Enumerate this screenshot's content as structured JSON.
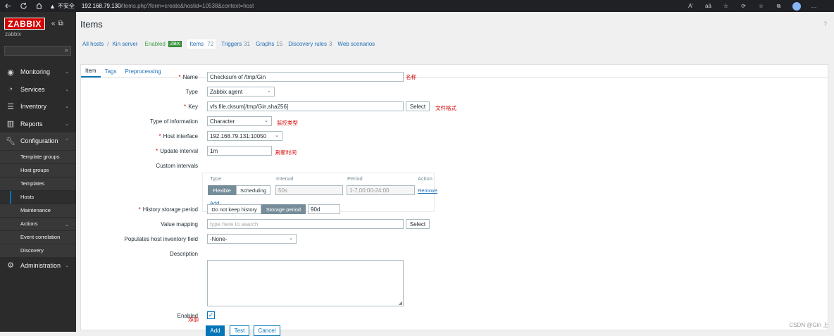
{
  "browser": {
    "security_label": "不安全",
    "url_host": "192.168.79.130",
    "url_path": "/items.php?form=create&hostid=10538&context=host",
    "read_aloud": "Aʹ",
    "translate": "aā"
  },
  "sidebar": {
    "logo": "ZABBIX",
    "server_name": "zabbix",
    "search_placeholder": "",
    "menu": [
      {
        "label": "Monitoring",
        "icon": "eye-icon"
      },
      {
        "label": "Services",
        "icon": "clock-icon"
      },
      {
        "label": "Inventory",
        "icon": "list-icon"
      },
      {
        "label": "Reports",
        "icon": "chart-icon"
      },
      {
        "label": "Configuration",
        "icon": "wrench-icon"
      },
      {
        "label": "Administration",
        "icon": "gear-icon"
      }
    ],
    "config_items": [
      "Template groups",
      "Host groups",
      "Templates",
      "Hosts",
      "Maintenance",
      "Actions",
      "Event correlation",
      "Discovery"
    ]
  },
  "page": {
    "title": "Items",
    "help": "?"
  },
  "breadcrumb": {
    "all_hosts": "All hosts",
    "separator": "/",
    "host": "Kin server",
    "enabled": "Enabled",
    "zbx": "ZBX",
    "items": "Items",
    "items_count": "72",
    "triggers": "Triggers",
    "triggers_count": "31",
    "graphs": "Graphs",
    "graphs_count": "15",
    "discovery": "Discovery rules",
    "discovery_count": "3",
    "web": "Web scenarios"
  },
  "tabs": [
    "Item",
    "Tags",
    "Preprocessing"
  ],
  "form": {
    "name_label": "Name",
    "name_value": "Checksum of /tmp/Gin",
    "name_note": "名称",
    "type_label": "Type",
    "type_value": "Zabbix agent",
    "key_label": "Key",
    "key_value": "vfs.file.cksum[/tmp/Gin,sha256]",
    "key_select": "Select",
    "key_note": "文件格式",
    "toi_label": "Type of information",
    "toi_value": "Character",
    "toi_note": "监控类型",
    "hi_label": "Host interface",
    "hi_value": "192.168.79.131:10050",
    "ui_label": "Update interval",
    "ui_value": "1m",
    "ui_note": "刷新时间",
    "ci_label": "Custom intervals",
    "ci_col_type": "Type",
    "ci_col_interval": "Interval",
    "ci_col_period": "Period",
    "ci_col_action": "Action",
    "ci_flexible": "Flexible",
    "ci_scheduling": "Scheduling",
    "ci_interval_ph": "50s",
    "ci_period_ph": "1-7,00:00-24:00",
    "ci_remove": "Remove",
    "ci_add": "Add",
    "hsp_label": "History storage period",
    "hsp_nokeep": "Do not keep history",
    "hsp_storage": "Storage period",
    "hsp_value": "90d",
    "vm_label": "Value mapping",
    "vm_placeholder": "type here to search",
    "vm_select": "Select",
    "phi_label": "Populates host inventory field",
    "phi_value": "-None-",
    "desc_label": "Description",
    "enabled_label": "Enabled",
    "add_note": "添加",
    "btn_add": "Add",
    "btn_test": "Test",
    "btn_cancel": "Cancel"
  },
  "watermark": "CSDN @Gin 上"
}
